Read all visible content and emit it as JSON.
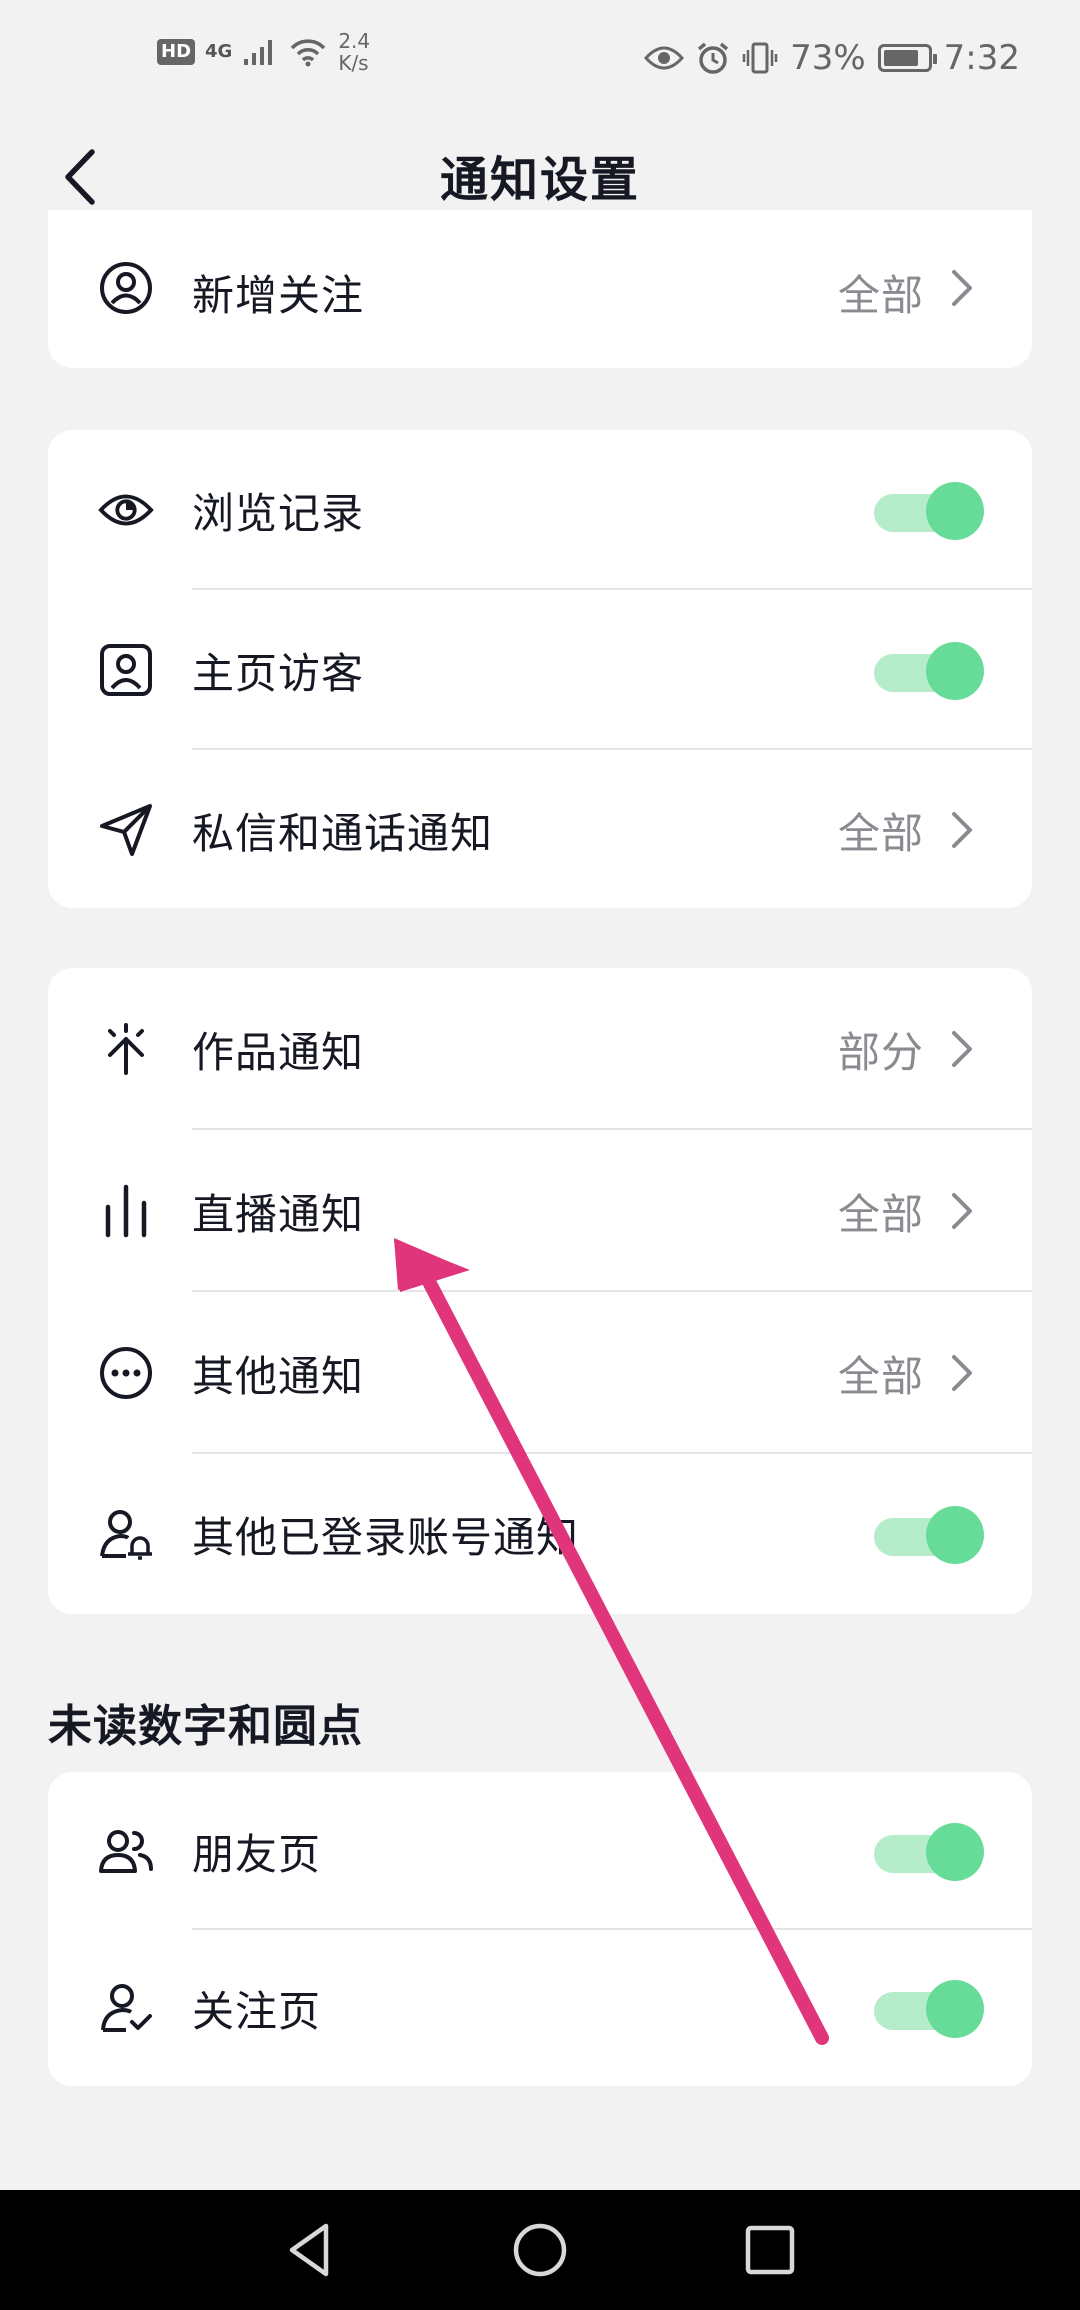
{
  "status_bar": {
    "hd": "HD",
    "network": "4G",
    "speed_value": "2.4",
    "speed_unit": "K/s",
    "battery": "73%",
    "time": "7:32"
  },
  "header": {
    "title": "通知设置"
  },
  "card1": {
    "rows": [
      {
        "label": "新增关注",
        "value": "全部",
        "icon": "person-circle-icon"
      }
    ]
  },
  "card2": {
    "rows": [
      {
        "label": "浏览记录",
        "toggle": true,
        "icon": "eye-icon"
      },
      {
        "label": "主页访客",
        "toggle": true,
        "icon": "profile-card-icon"
      },
      {
        "label": "私信和通话通知",
        "value": "全部",
        "icon": "send-icon"
      }
    ]
  },
  "card3": {
    "rows": [
      {
        "label": "作品通知",
        "value": "部分",
        "icon": "spark-icon"
      },
      {
        "label": "直播通知",
        "value": "全部",
        "icon": "bar-chart-icon"
      },
      {
        "label": "其他通知",
        "value": "全部",
        "icon": "more-dots-icon"
      },
      {
        "label": "其他已登录账号通知",
        "toggle": true,
        "icon": "person-bell-icon"
      }
    ]
  },
  "section_unread": {
    "title": "未读数字和圆点"
  },
  "card4": {
    "rows": [
      {
        "label": "朋友页",
        "toggle": true,
        "icon": "friends-icon"
      },
      {
        "label": "关注页",
        "toggle": true,
        "icon": "person-check-icon"
      }
    ]
  },
  "colors": {
    "toggle_on_knob": "#66dc98",
    "toggle_on_track": "#b5ecc9",
    "annotation_arrow": "#e0357a"
  }
}
